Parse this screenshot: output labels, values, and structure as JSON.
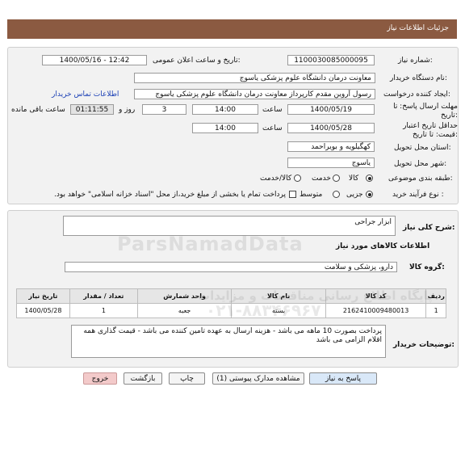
{
  "header": {
    "title": "جزئیات اطلاعات نیاز"
  },
  "form": {
    "need_number_label": "شماره نیاز:",
    "need_number": "1100030085000095",
    "announce_label": "تاریخ و ساعت اعلان عمومی:",
    "announce_value": "1400/05/16 - 12:42",
    "buyer_org_label": "نام دستگاه خریدار:",
    "buyer_org": "معاونت درمان دانشگاه علوم پزشکی یاسوج",
    "creator_label": "ایجاد کننده درخواست:",
    "creator": "رسول آروین مقدم کارپرداز معاونت درمان دانشگاه علوم پزشکی یاسوج",
    "contact_link": "اطلاعات تماس خریدار",
    "deadline_label": "مهلت ارسال پاسخ: تا تاریخ:",
    "deadline_date": "1400/05/19",
    "time_label": "ساعت",
    "deadline_time": "14:00",
    "days_value": "3",
    "days_label": "روز و",
    "remaining_time": "01:11:55",
    "remaining_label": "ساعت باقی مانده",
    "validity_label": "حداقل تاریخ اعتبار قیمت: تا تاریخ:",
    "validity_date": "1400/05/28",
    "validity_time": "14:00",
    "province_label": "استان محل تحویل:",
    "province": "کهگیلویه و بویراحمد",
    "city_label": "شهر محل تحویل:",
    "city": "یاسوج",
    "category_label": "طبقه بندی موضوعی:",
    "category_options": [
      "کالا",
      "خدمت",
      "کالا/خدمت"
    ],
    "process_label": "نوع فرآیند خرید :",
    "process_options": [
      "جزیی",
      "متوسط"
    ],
    "payment_note": "پرداخت تمام یا بخشی از مبلغ خرید،از محل \"اسناد خزانه اسلامی\" خواهد بود."
  },
  "need": {
    "summary_label": "شرح کلی نیاز:",
    "summary": "ابزار جراحی",
    "goods_info_title": "اطلاعات کالاهای مورد نیاز",
    "group_label": "گروه کالا:",
    "group_value": "دارو، پزشکی و سلامت"
  },
  "table": {
    "headers": [
      "ردیف",
      "کد کالا",
      "نام کالا",
      "واحد شمارش",
      "تعداد / مقدار",
      "تاریخ نیاز"
    ],
    "rows": [
      [
        "1",
        "2162410009480013",
        "بسته",
        "جعبه",
        "1",
        "1400/05/28"
      ]
    ]
  },
  "notes": {
    "label": "توضیحات خریدار:",
    "text": "پرداخت بصورت 10 ماهه می باشد - هزینه ارسال به عهده تامین کننده می باشد - قیمت گذاری همه اقلام الزامی می باشد"
  },
  "buttons": {
    "reply": "پاسخ به نیاز",
    "attachments": "مشاهده مدارک پیوستی (1)",
    "print": "چاپ",
    "back": "بازگشت",
    "exit": "خروج"
  },
  "watermark": {
    "brand": "ParsNamadData",
    "line1": "پایگاه اطلاع رسانی مناقصات و مزایدات",
    "line2": "۰۲۱-۸۸۳۴۶۹۶۷"
  },
  "colors": {
    "header_bg": "#8b5a41",
    "link": "#1a3fb5",
    "exit_button": "#f3caca"
  }
}
